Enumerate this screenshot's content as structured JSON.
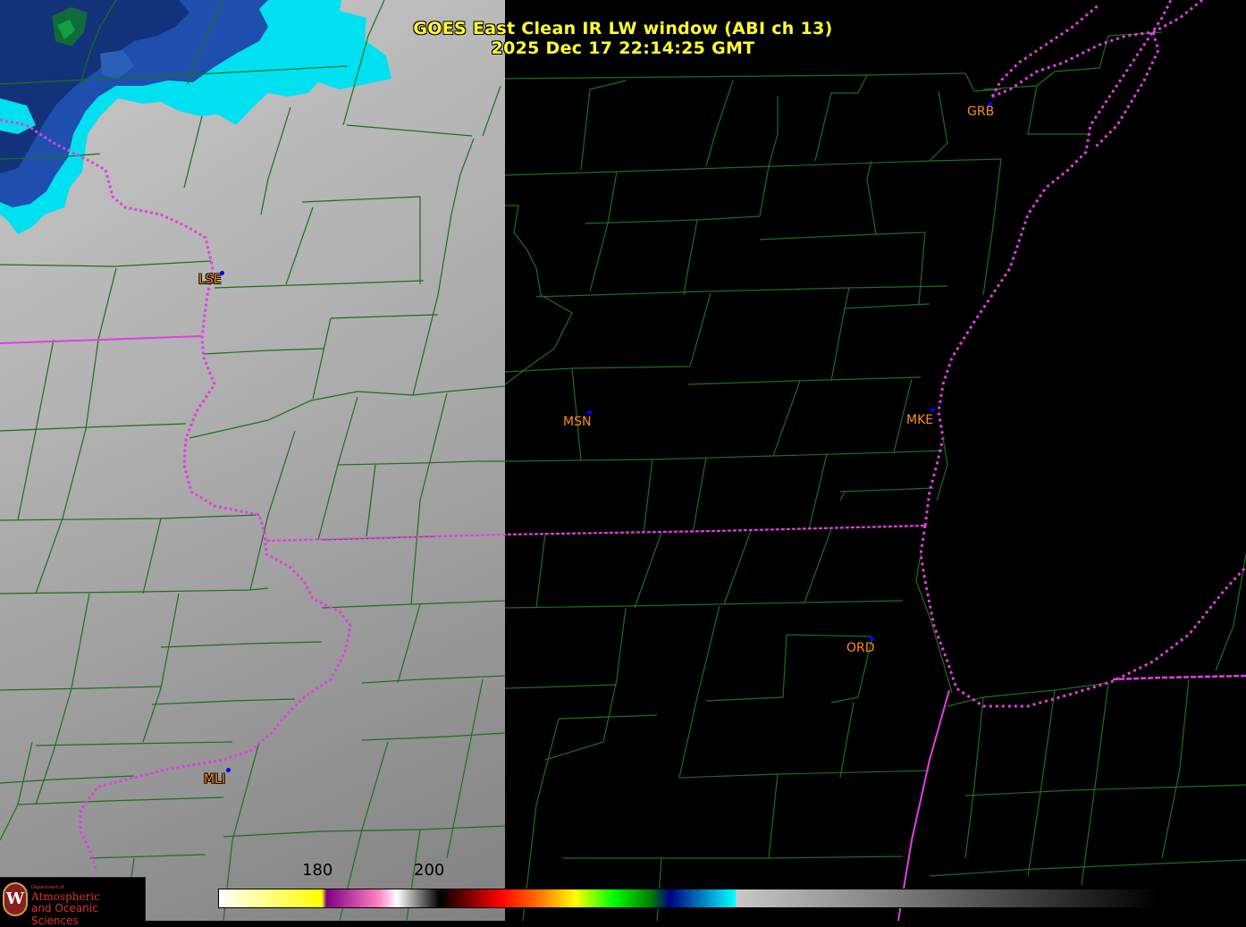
{
  "title": {
    "line1": "GOES East Clean IR LW window (ABI ch 13)",
    "line2": "2025 Dec 17  22:14:25 GMT"
  },
  "stations": [
    {
      "id": "GRB",
      "style": "light"
    },
    {
      "id": "LSE",
      "style": "dark"
    },
    {
      "id": "MSN",
      "style": "light"
    },
    {
      "id": "MKE",
      "style": "light"
    },
    {
      "id": "ORD",
      "style": "light"
    },
    {
      "id": "MLI",
      "style": "dark"
    }
  ],
  "colorbar": {
    "tick_labels": [
      "180",
      "200"
    ],
    "gradient_stops": [
      {
        "color": "#ffffff",
        "pos": 0.0
      },
      {
        "color": "#ffff00",
        "pos": 0.11
      },
      {
        "color": "#800080",
        "pos": 0.115
      },
      {
        "color": "#ff80c0",
        "pos": 0.17
      },
      {
        "color": "#ffffff",
        "pos": 0.19
      },
      {
        "color": "#000000",
        "pos": 0.235
      },
      {
        "color": "#ff0000",
        "pos": 0.3
      },
      {
        "color": "#ff8000",
        "pos": 0.345
      },
      {
        "color": "#ffff00",
        "pos": 0.38
      },
      {
        "color": "#00ff00",
        "pos": 0.42
      },
      {
        "color": "#008000",
        "pos": 0.46
      },
      {
        "color": "#000080",
        "pos": 0.48
      },
      {
        "color": "#00ffff",
        "pos": 0.55
      },
      {
        "color": "#c8c8c8",
        "pos": 0.551
      },
      {
        "color": "#000000",
        "pos": 1.0
      }
    ]
  },
  "colors": {
    "county_lines": "#1e6e1e",
    "state_borders": "#e040e0",
    "ir_gray_top": "#c4c4c4",
    "ir_gray_bottom": "#8c8c8c",
    "cloud_cyan": "#00e5ff",
    "cloud_blue": "#1a3f9c",
    "station_label": "#ff8c1a",
    "station_dot": "#0000ff",
    "title": "#ffff33"
  },
  "logo": {
    "seal_letter": "W",
    "dept_small": "Department of",
    "line1": "Atmospheric",
    "line2": "and Oceanic Sciences"
  }
}
